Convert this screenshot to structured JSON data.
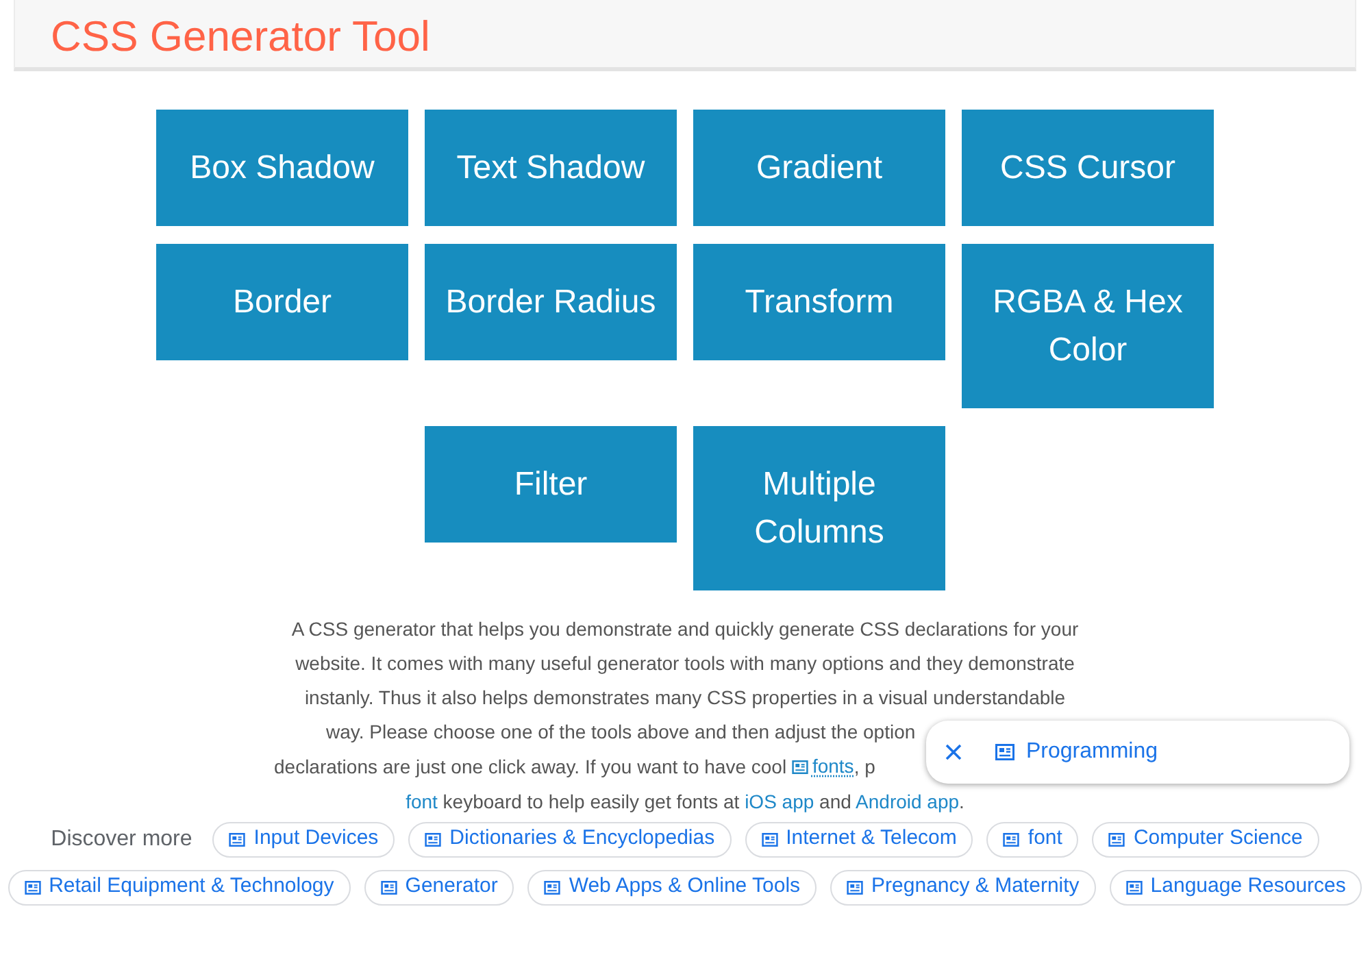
{
  "header": {
    "title": "CSS Generator Tool"
  },
  "tools": [
    "Box Shadow",
    "Text Shadow",
    "Gradient",
    "CSS Cursor",
    "Border",
    "Border Radius",
    "Transform",
    "RGBA & Hex Color",
    "Filter",
    "Multiple Columns"
  ],
  "description": {
    "lines": [
      {
        "segments": [
          {
            "kind": "text",
            "text": "A CSS generator that helps you demonstrate and quickly generate CSS declarations for your"
          }
        ]
      },
      {
        "segments": [
          {
            "kind": "text",
            "text": "website. It comes with many useful generator tools with many options and they demonstrate"
          }
        ]
      },
      {
        "segments": [
          {
            "kind": "text",
            "text": "instanly. Thus it also helps demonstrates many CSS properties in a visual understandable"
          }
        ]
      },
      {
        "segments": [
          {
            "kind": "text",
            "text": "way. Please choose one of the tools above and then adjust the option"
          }
        ]
      },
      {
        "segments": [
          {
            "kind": "text",
            "text": "declarations are just one click away. If you want to have cool "
          },
          {
            "kind": "keyword",
            "text": "fonts"
          },
          {
            "kind": "text",
            "text": ", p"
          }
        ]
      },
      {
        "segments": [
          {
            "kind": "link",
            "text": "font"
          },
          {
            "kind": "text",
            "text": " keyboard to help easily get fonts at "
          },
          {
            "kind": "link",
            "text": "iOS app"
          },
          {
            "kind": "text",
            "text": " and "
          },
          {
            "kind": "link",
            "text": "Android app"
          },
          {
            "kind": "text",
            "text": "."
          }
        ]
      }
    ]
  },
  "popup": {
    "label": "Programming"
  },
  "discover": {
    "label": "Discover more",
    "topics": [
      "Input Devices",
      "Dictionaries & Encyclopedias",
      "Internet & Telecom",
      "font",
      "Computer Science",
      "Retail Equipment & Technology",
      "Generator",
      "Web Apps & Online Tools",
      "Pregnancy & Maternity",
      "Language Resources"
    ]
  }
}
